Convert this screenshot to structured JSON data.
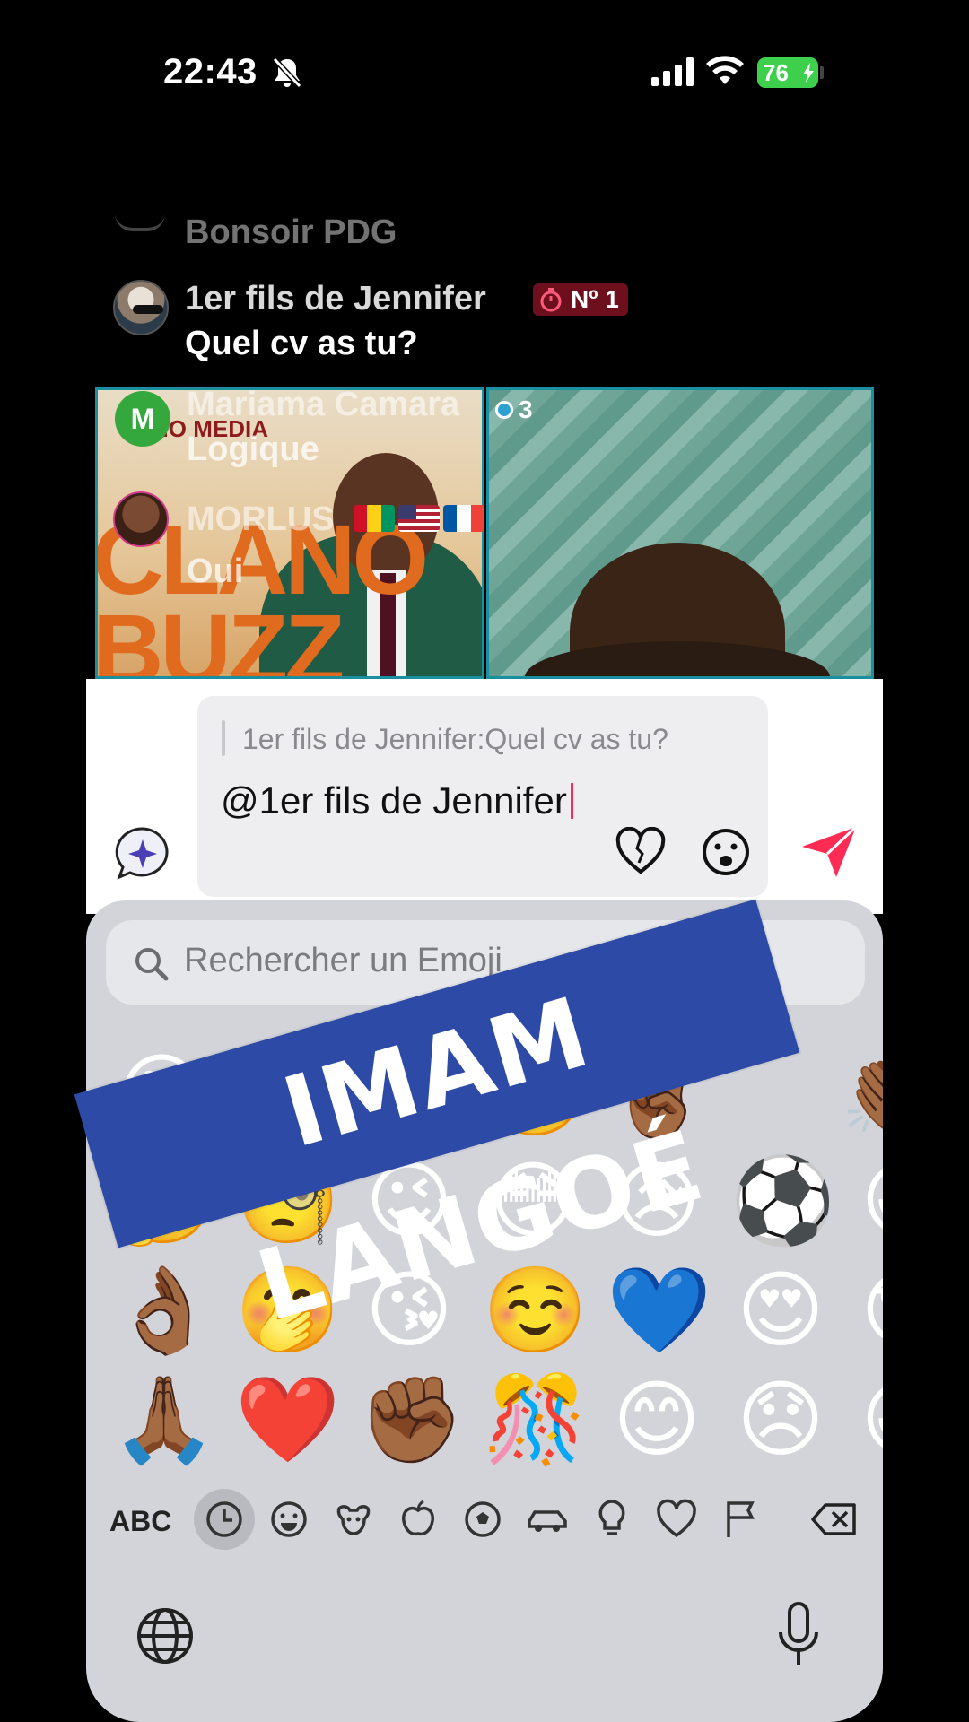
{
  "status_bar": {
    "time": "22:43",
    "battery": "76",
    "silent": true
  },
  "chat": {
    "faded_message": {
      "text": "Bonsoir PDG"
    },
    "main_message": {
      "author": "1er fils de Jennifer",
      "badge": "Nº 1",
      "text": "Quel cv as tu?"
    }
  },
  "live": {
    "viewer_count": "3",
    "overlay_comments": [
      {
        "avatar_letter": "M",
        "author": "Mariama Camara",
        "text": "Logique"
      },
      {
        "author": "MORLUS",
        "text": "Oui"
      }
    ],
    "poster": {
      "media_label": "NO MEDIA",
      "big_text": "CLANO BUZZ"
    }
  },
  "composer": {
    "reply_preview": "1er fils de Jennifer:Quel cv as tu?",
    "input_value": "@1er fils de Jennifer",
    "accent_color": "#fe2c55"
  },
  "keyboard": {
    "search_placeholder": "Rechercher un Emoji",
    "abc_label": "ABC",
    "emoji_rows": [
      [
        "😄",
        "🙄",
        "🌵",
        "🥲",
        "✌🏾",
        "👏🏾"
      ],
      [
        "🤔",
        "🧐",
        "😉",
        "😳",
        "😥",
        "⚽",
        "😆"
      ],
      [
        "👌🏾",
        "🤭",
        "😘",
        "☺️",
        "💙",
        "😍",
        "😎"
      ],
      [
        "🙏🏾",
        "❤️",
        "✊🏾",
        "🎊",
        "😊",
        "😞",
        "😃"
      ]
    ]
  },
  "watermark": {
    "text": "IMAM LANGOÉ",
    "color": "#2c4aa6"
  }
}
